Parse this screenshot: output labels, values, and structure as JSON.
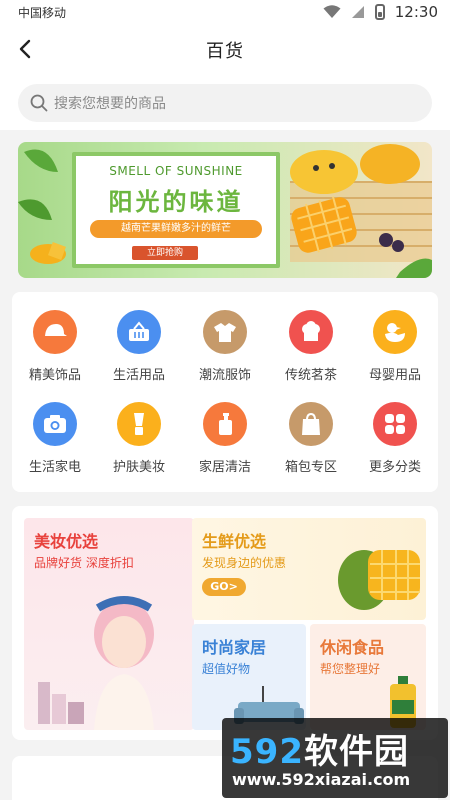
{
  "status_bar": {
    "carrier": "中国移动",
    "time": "12:30"
  },
  "nav": {
    "title": "百货"
  },
  "search": {
    "placeholder": "搜索您想要的商品"
  },
  "banner": {
    "english_title": "SMELL OF SUNSHINE",
    "chinese_title": "阳光的味道",
    "subtitle": "越南芒果鲜嫩多汁的鲜芒",
    "button": "立即抢购"
  },
  "categories": [
    {
      "label": "精美饰品",
      "icon": "cap-icon",
      "color": "#f6793c"
    },
    {
      "label": "生活用品",
      "icon": "basket-icon",
      "color": "#4b8ff0"
    },
    {
      "label": "潮流服饰",
      "icon": "tshirt-icon",
      "color": "#c69a6a"
    },
    {
      "label": "传统茗茶",
      "icon": "tea-icon",
      "color": "#f0524f"
    },
    {
      "label": "母婴用品",
      "icon": "duck-icon",
      "color": "#fbb01c"
    },
    {
      "label": "生活家电",
      "icon": "camera-icon",
      "color": "#4b8ff0"
    },
    {
      "label": "护肤美妆",
      "icon": "cosmetics-icon",
      "color": "#fbb01c"
    },
    {
      "label": "家居清洁",
      "icon": "bottle-icon",
      "color": "#f6793c"
    },
    {
      "label": "箱包专区",
      "icon": "bag-icon",
      "color": "#c69a6a"
    },
    {
      "label": "更多分类",
      "icon": "grid-icon",
      "color": "#f0524f"
    }
  ],
  "promo": {
    "beauty": {
      "title": "美妆优选",
      "subtitle": "品牌好货 深度折扣",
      "color": "#e8423d"
    },
    "fresh": {
      "title": "生鲜优选",
      "subtitle": "发现身边的优惠",
      "button": "GO>",
      "color": "#e49b1a"
    },
    "home": {
      "title": "时尚家居",
      "subtitle": "超值好物",
      "color": "#3a82d6"
    },
    "snack": {
      "title": "休闲食品",
      "subtitle": "帮您整理好",
      "color": "#e8793a"
    }
  },
  "watermark": {
    "number": "592",
    "brand": "软件园",
    "url": "www.592xiazai.com"
  }
}
